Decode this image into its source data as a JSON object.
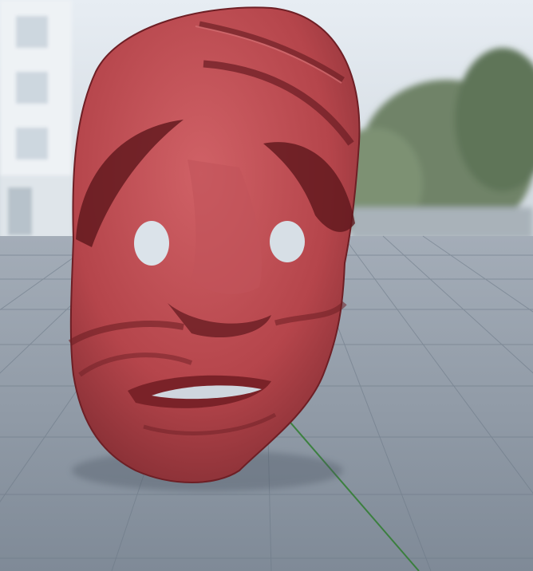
{
  "scene": {
    "kind": "3d-viewport-render",
    "subject": "carved-mask-icon",
    "background": {
      "sky_color": "#dfe6ee",
      "building_color": "#e8eef3",
      "foliage_color": "#6f8367",
      "horizon_haze": "#c9d1d8"
    },
    "floor": {
      "color": "#8e99a6",
      "grid_line_color": "#5d6b78",
      "axis_line_color": "#2f7d2f"
    },
    "mask": {
      "base_color": "#b5454b",
      "shadow_color": "#6e1f25",
      "highlight_color": "#d9777a",
      "mouth_slot_color": "#cfd6de"
    }
  }
}
